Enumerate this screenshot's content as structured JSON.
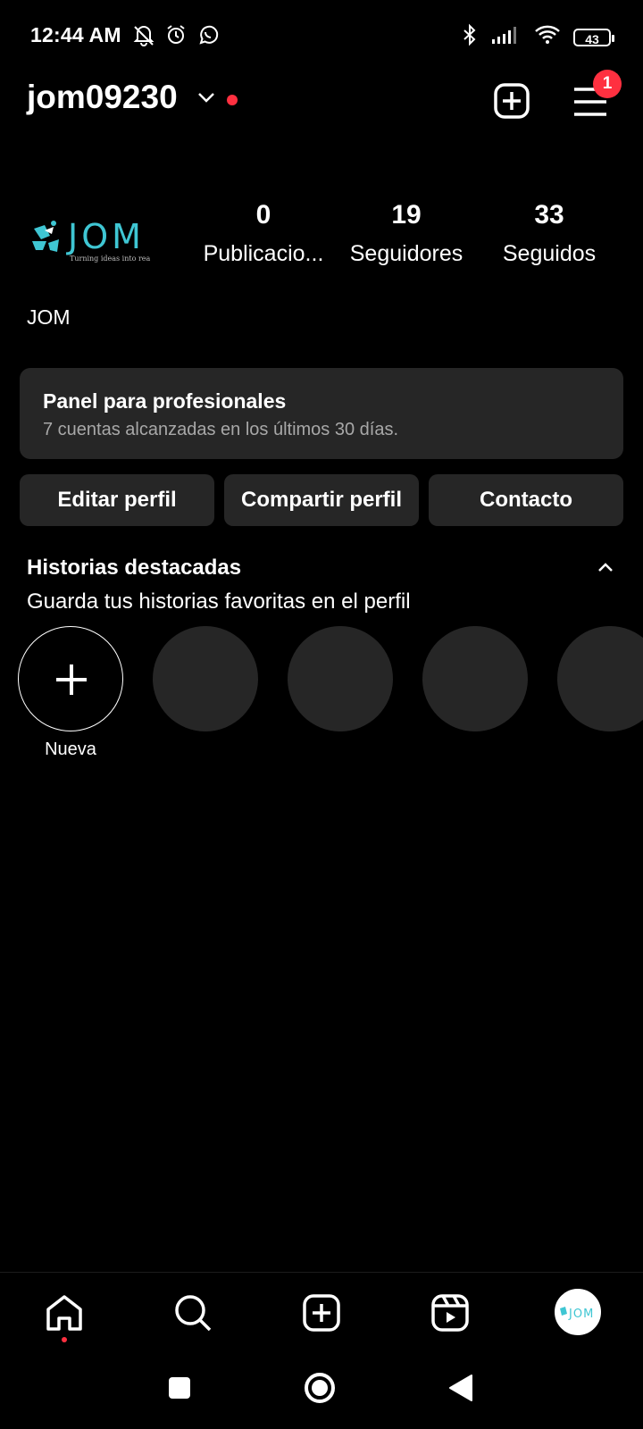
{
  "status_bar": {
    "time": "12:44 AM",
    "battery": "43",
    "icons": [
      "mute-bell-icon",
      "alarm-icon",
      "whatsapp-icon",
      "bluetooth-icon",
      "signal-icon",
      "wifi-icon",
      "battery-icon"
    ]
  },
  "header": {
    "username": "jom09230",
    "notification_count": "1",
    "icons": [
      "chevron-down-icon",
      "add-post-icon",
      "menu-icon"
    ]
  },
  "profile": {
    "logo_text": "JOM",
    "logo_tagline": "Turning ideas into rea",
    "stats": [
      {
        "value": "0",
        "label": "Publicacio..."
      },
      {
        "value": "19",
        "label": "Seguidores"
      },
      {
        "value": "33",
        "label": "Seguidos"
      }
    ],
    "display_name": "JOM"
  },
  "pro_panel": {
    "title": "Panel para profesionales",
    "subtitle": "7 cuentas alcanzadas en los últimos 30 días."
  },
  "actions": [
    "Editar perfil",
    "Compartir perfil",
    "Contacto"
  ],
  "highlights": {
    "title": "Historias destacadas",
    "subtitle": "Guarda tus historias favoritas en el perfil",
    "new_label": "Nueva"
  },
  "nav": [
    "home-icon",
    "search-icon",
    "create-icon",
    "reels-icon",
    "profile-avatar"
  ],
  "colors": {
    "background": "#000000",
    "surface": "#262626",
    "accent_red": "#ff3040",
    "logo_teal": "#3fc6d3"
  }
}
